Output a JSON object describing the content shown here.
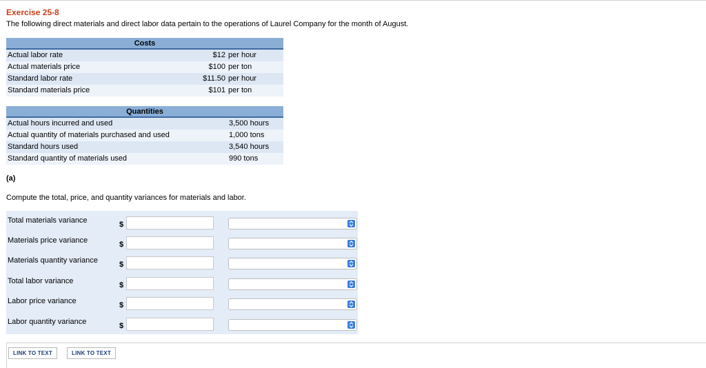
{
  "exercise": {
    "title": "Exercise 25-8",
    "intro": "The following direct materials and direct labor data pertain to the operations of Laurel Company for the month of August."
  },
  "costs": {
    "header": "Costs",
    "rows": [
      {
        "label": "Actual labor rate",
        "amount": "$12",
        "unit": "per hour"
      },
      {
        "label": "Actual materials price",
        "amount": "$100",
        "unit": "per ton"
      },
      {
        "label": "Standard labor rate",
        "amount": "$11.50",
        "unit": "per hour"
      },
      {
        "label": "Standard materials price",
        "amount": "$101",
        "unit": "per ton"
      }
    ]
  },
  "quantities": {
    "header": "Quantities",
    "rows": [
      {
        "label": "Actual hours incurred and used",
        "value": "3,500 hours"
      },
      {
        "label": "Actual quantity of materials purchased and used",
        "value": "1,000 tons"
      },
      {
        "label": "Standard hours used",
        "value": "3,540 hours"
      },
      {
        "label": "Standard quantity of materials used",
        "value": "990 tons"
      }
    ]
  },
  "part_a": {
    "heading": "(a)",
    "instruction": "Compute the total, price, and quantity variances for materials and labor.",
    "currency_symbol": "$",
    "rows": [
      {
        "label": "Total materials variance",
        "input_value": "",
        "select_value": ""
      },
      {
        "label": "Materials price variance",
        "input_value": "",
        "select_value": ""
      },
      {
        "label": "Materials quantity variance",
        "input_value": "",
        "select_value": ""
      },
      {
        "label": "Total labor variance",
        "input_value": "",
        "select_value": ""
      },
      {
        "label": "Labor price variance",
        "input_value": "",
        "select_value": ""
      },
      {
        "label": "Labor quantity variance",
        "input_value": "",
        "select_value": ""
      }
    ],
    "select_icon": "updown-chevron-icon"
  },
  "links": [
    "LINK TO TEXT",
    "LINK TO TEXT"
  ],
  "colors": {
    "title": "#c8401a",
    "table_header": "#8aaed6",
    "table_row_alt": "#dde7f4",
    "answer_panel": "#e3ecf7",
    "select_button": "#3b7ddd"
  }
}
